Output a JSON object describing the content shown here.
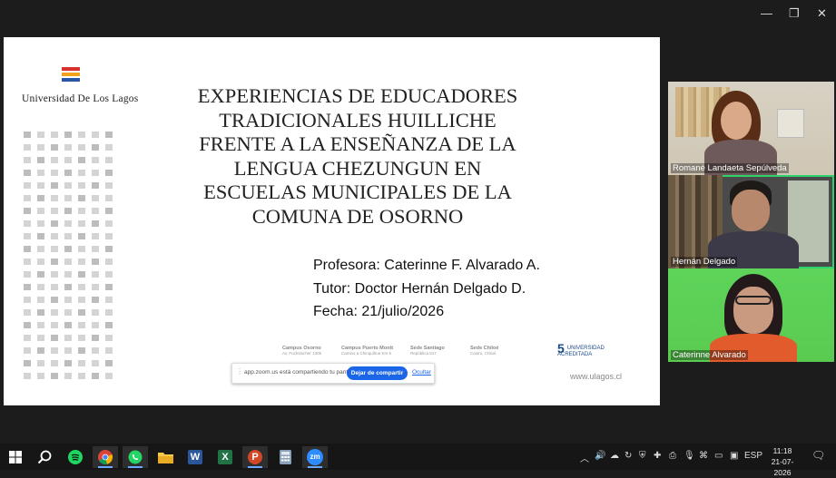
{
  "window": {
    "minimize_glyph": "—",
    "restore_glyph": "❐",
    "close_glyph": "✕"
  },
  "slide": {
    "university": "Universidad De Los Lagos",
    "title_lines": [
      "EXPERIENCIAS DE EDUCADORES",
      "TRADICIONALES HUILLICHE",
      "FRENTE A LA ENSEÑANZA DE LA",
      "LENGUA CHEZUNGUN EN",
      "ESCUELAS MUNICIPALES DE LA",
      "COMUNA DE OSORNO"
    ],
    "profesora": "Profesora: Caterinne  F. Alvarado A.",
    "tutor": "Tutor: Doctor Hernán Delgado D.",
    "fecha": "Fecha: 21/julio/2026",
    "footer": {
      "campus_osorno": "Campus Osorno",
      "campus_osorno_addr": "Av. Fuchslocher 1305",
      "campus_pm": "Campus Puerto Montt",
      "campus_pm_addr": "Camino a Chinquihue Km 6",
      "sede_santiago": "Sede Santiago",
      "sede_santiago_addr": "República 517",
      "sede_chiloe": "Sede Chiloé",
      "sede_chiloe_addr": "Castro, Chiloé",
      "url": "www.ulagos.cl",
      "badge": "UNIVERSIDAD ACREDITADA",
      "badge_years": "5"
    },
    "colors": {
      "flag_red": "#d6322b",
      "flag_orange": "#f3a21c",
      "flag_blue": "#2a57a4",
      "dots": "#c9c9c9"
    }
  },
  "share_bar": {
    "message": "app.zoom.us está compartiendo tu pantalla.",
    "stop_label": "Dejar de compartir",
    "hide_label": "Ocultar"
  },
  "participants": [
    {
      "name": "Romané Landaeta Sepúlveda"
    },
    {
      "name": "Hernán Delgado"
    },
    {
      "name": "Caterinne Alvarado"
    }
  ],
  "taskbar": {
    "apps": [
      "start-icon",
      "search-icon",
      "spotify-icon",
      "chrome-icon",
      "whatsapp-icon",
      "file-explorer-icon",
      "word-icon",
      "excel-icon",
      "powerpoint-icon",
      "calculator-icon",
      "zoom-icon"
    ],
    "zoom_label": "zm",
    "word_label": "W",
    "excel_label": "X",
    "ppt_label": "P",
    "language": "ESP",
    "time": "11:18",
    "date": "21-07-2026"
  }
}
